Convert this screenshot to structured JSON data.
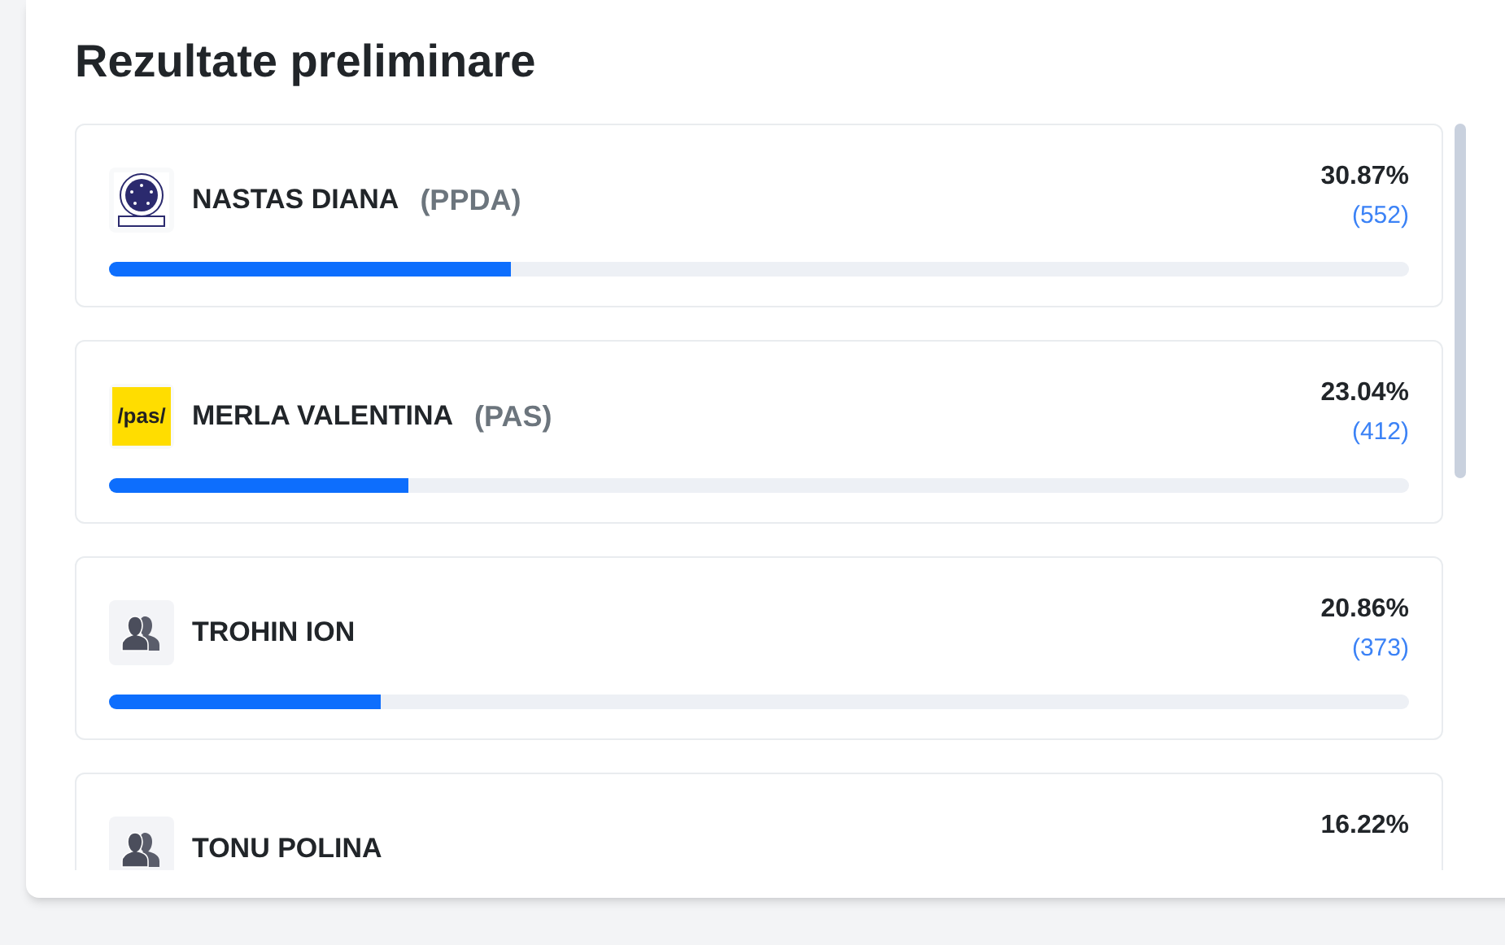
{
  "title": "Rezultate preliminare",
  "candidates": [
    {
      "name": "NASTAS DIANA",
      "party": "(PPDA)",
      "logo": {
        "kind": "emblem"
      },
      "percent": "30.87%",
      "votes": "(552)",
      "level": 0.3087
    },
    {
      "name": "MERLA VALENTINA",
      "party": "(PAS)",
      "logo": {
        "kind": "text",
        "text": "/pas/"
      },
      "percent": "23.04%",
      "votes": "(412)",
      "level": 0.2304
    },
    {
      "name": "TROHIN ION",
      "logo": {
        "kind": "silhouette"
      },
      "percent": "20.86%",
      "votes": "(373)",
      "level": 0.2086
    },
    {
      "name": "TONU POLINA",
      "logo": {
        "kind": "silhouette"
      },
      "percent": "16.22%"
    }
  ]
}
